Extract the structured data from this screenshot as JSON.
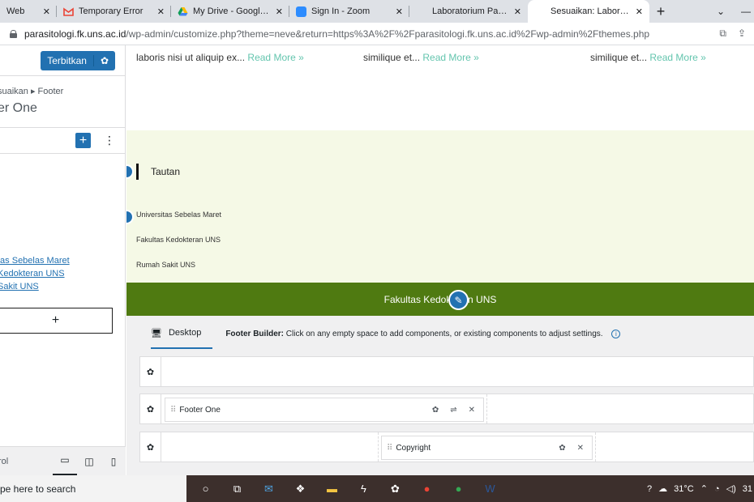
{
  "browser": {
    "tabs": [
      {
        "title": "Web",
        "favicon": "web-icon",
        "color": "#5f6368"
      },
      {
        "title": "Temporary Error",
        "favicon": "gmail-icon",
        "color": "#ea4335"
      },
      {
        "title": "My Drive - Google Dri",
        "favicon": "google-drive-icon",
        "color": "#1a73e8"
      },
      {
        "title": "Sign In - Zoom",
        "favicon": "zoom-icon",
        "color": "#2d8cff"
      },
      {
        "title": "Laboratorium Parasito",
        "favicon": "web-icon",
        "color": "#5f6368"
      },
      {
        "title": "Sesuaikan: Laboratori",
        "favicon": "web-icon",
        "color": "#5f6368"
      }
    ],
    "active_tab": 5,
    "new_tab": "+",
    "url_domain": "parasitologi.fk.uns.ac.id",
    "url_path": "/wp-admin/customize.php?theme=neve&return=https%3A%2F%2Fparasitologi.fk.uns.ac.id%2Fwp-admin%2Fthemes.php"
  },
  "sidebar": {
    "publish_label": "Terbitkan",
    "breadcrumb": "suaikan ▸ Footer",
    "section_title": "er One",
    "links": [
      "tas Sebelas Maret",
      "Kedokteran UNS",
      "Sakit UNS"
    ],
    "add_block": "+",
    "footer_label": "rol"
  },
  "preview": {
    "excerpts": [
      {
        "text": "laboris nisi ut aliquip ex...",
        "link": "Read More »"
      },
      {
        "text": "similique et...",
        "link": "Read More »"
      },
      {
        "text": "similique et...",
        "link": "Read More »"
      }
    ],
    "widget_title": "Tautan",
    "footer_links": [
      "Universitas Sebelas Maret",
      "Fakultas Kedokteran UNS",
      "Rumah Sakit UNS"
    ],
    "copyright_text": "Fakultas Kedokteran UNS",
    "colors": {
      "light_footer": "#f5f9e6",
      "green_bar": "#4f7a11",
      "link": "#64c5ae",
      "accent": "#2271b1"
    }
  },
  "builder": {
    "desktop_label": "Desktop",
    "desc_bold": "Footer Builder:",
    "desc_text": "Click on any empty space to add components, or existing components to adjust settings.",
    "rows": [
      {
        "components": []
      },
      {
        "components": [
          "Footer One"
        ]
      },
      {
        "components": [
          "Copyright"
        ]
      }
    ]
  },
  "taskbar": {
    "search_placeholder": "pe here to search",
    "temperature": "31°C",
    "clock": "31"
  }
}
